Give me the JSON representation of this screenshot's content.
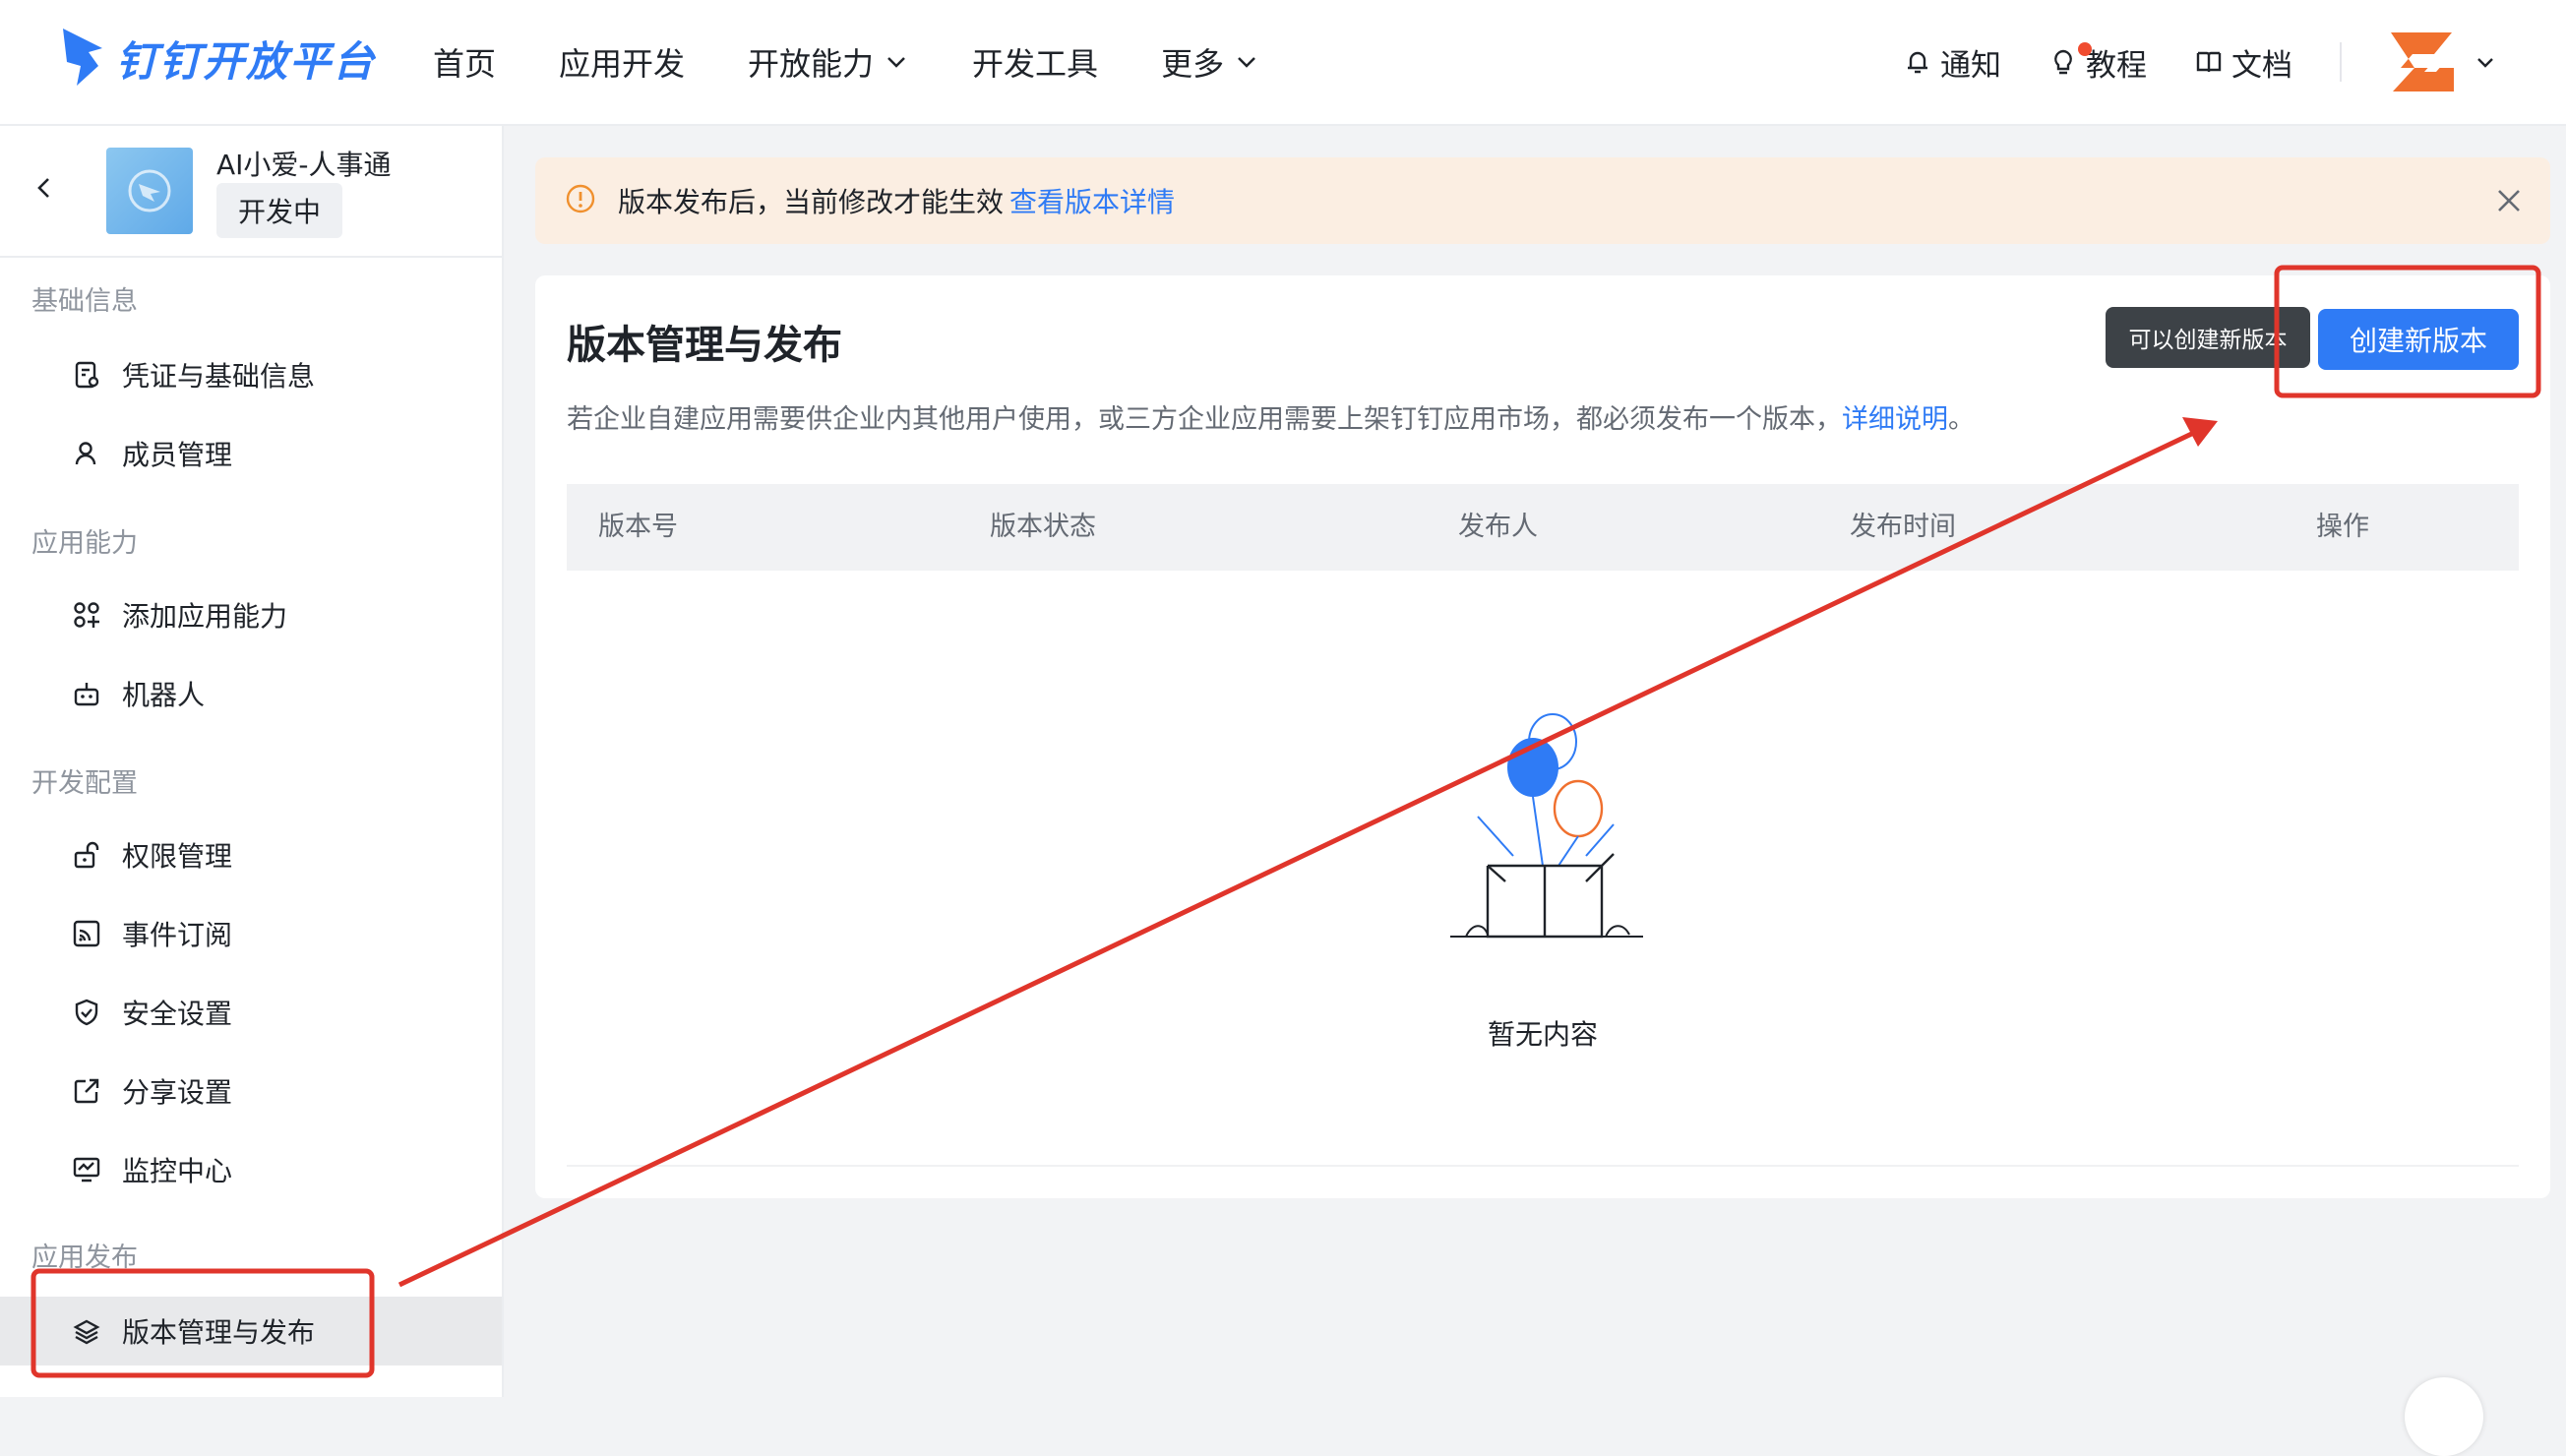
{
  "header": {
    "logo_text": "钉钉开放平台",
    "nav": [
      {
        "label": "首页"
      },
      {
        "label": "应用开发"
      },
      {
        "label": "开放能力"
      },
      {
        "label": "开发工具"
      },
      {
        "label": "更多"
      }
    ],
    "links": {
      "notify": "通知",
      "tutorial": "教程",
      "docs": "文档"
    }
  },
  "app": {
    "name": "AI小爱-人事通",
    "status": "开发中"
  },
  "sidebar": {
    "sections": [
      {
        "title": "基础信息",
        "items": [
          {
            "label": "凭证与基础信息",
            "icon": "credential-icon"
          },
          {
            "label": "成员管理",
            "icon": "user-icon"
          }
        ]
      },
      {
        "title": "应用能力",
        "items": [
          {
            "label": "添加应用能力",
            "icon": "apps-add-icon"
          },
          {
            "label": "机器人",
            "icon": "robot-icon"
          }
        ]
      },
      {
        "title": "开发配置",
        "items": [
          {
            "label": "权限管理",
            "icon": "lock-icon"
          },
          {
            "label": "事件订阅",
            "icon": "rss-icon"
          },
          {
            "label": "安全设置",
            "icon": "shield-icon"
          },
          {
            "label": "分享设置",
            "icon": "share-icon"
          },
          {
            "label": "监控中心",
            "icon": "monitor-icon"
          }
        ]
      },
      {
        "title": "应用发布",
        "items": [
          {
            "label": "版本管理与发布",
            "icon": "layers-icon",
            "active": true
          }
        ]
      }
    ]
  },
  "notice": {
    "text": "版本发布后，当前修改才能生效",
    "link": "查看版本详情"
  },
  "main": {
    "title": "版本管理与发布",
    "desc_prefix": "若企业自建应用需要供企业内其他用户使用，或三方企业应用需要上架钉钉应用市场，都必须发布一个版本，",
    "desc_link": "详细说明",
    "desc_suffix": "。",
    "tooltip": "可以创建新版本",
    "create_button": "创建新版本",
    "table_headers": [
      "版本号",
      "版本状态",
      "发布人",
      "发布时间",
      "操作"
    ],
    "empty_text": "暂无内容"
  },
  "colors": {
    "primary": "#2f7bf5",
    "annotation": "#e0352b",
    "notice_bg": "#fbeee2"
  }
}
